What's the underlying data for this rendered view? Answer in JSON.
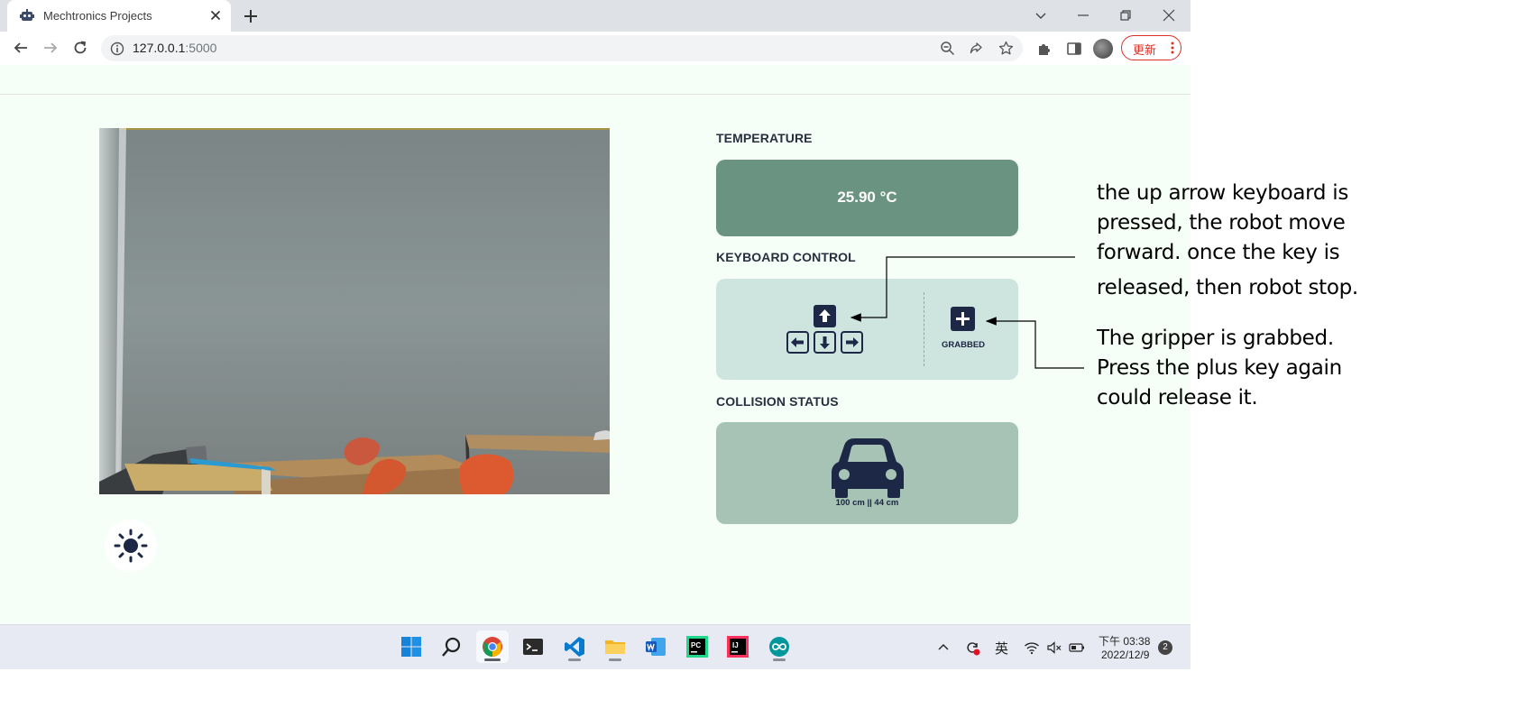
{
  "browser": {
    "tab_title": "Mechtronics Projects",
    "url_host": "127.0.0.1",
    "url_port": ":5000",
    "update_label": "更新"
  },
  "page": {
    "temperature": {
      "title": "TEMPERATURE",
      "value": "25.90 °C"
    },
    "keyboard": {
      "title": "KEYBOARD CONTROL",
      "gripper_status": "GRABBED"
    },
    "collision": {
      "title": "COLLISION STATUS",
      "distances": "100 cm || 44 cm"
    }
  },
  "taskbar": {
    "apps": [
      "windows-start",
      "search",
      "chrome",
      "terminal",
      "vscode",
      "file-explorer",
      "word",
      "pycharm",
      "intellij",
      "arduino"
    ],
    "ime": "英",
    "time": "下午 03:38",
    "date": "2022/12/9",
    "notifications": "2"
  },
  "annotations": {
    "arrow_key": [
      "the up arrow keyboard is",
      "pressed, the robot move",
      "forward. once the key is",
      "released, then  robot stop."
    ],
    "gripper": [
      "The gripper is grabbed.",
      "Press the plus key again",
      "could release it."
    ]
  }
}
